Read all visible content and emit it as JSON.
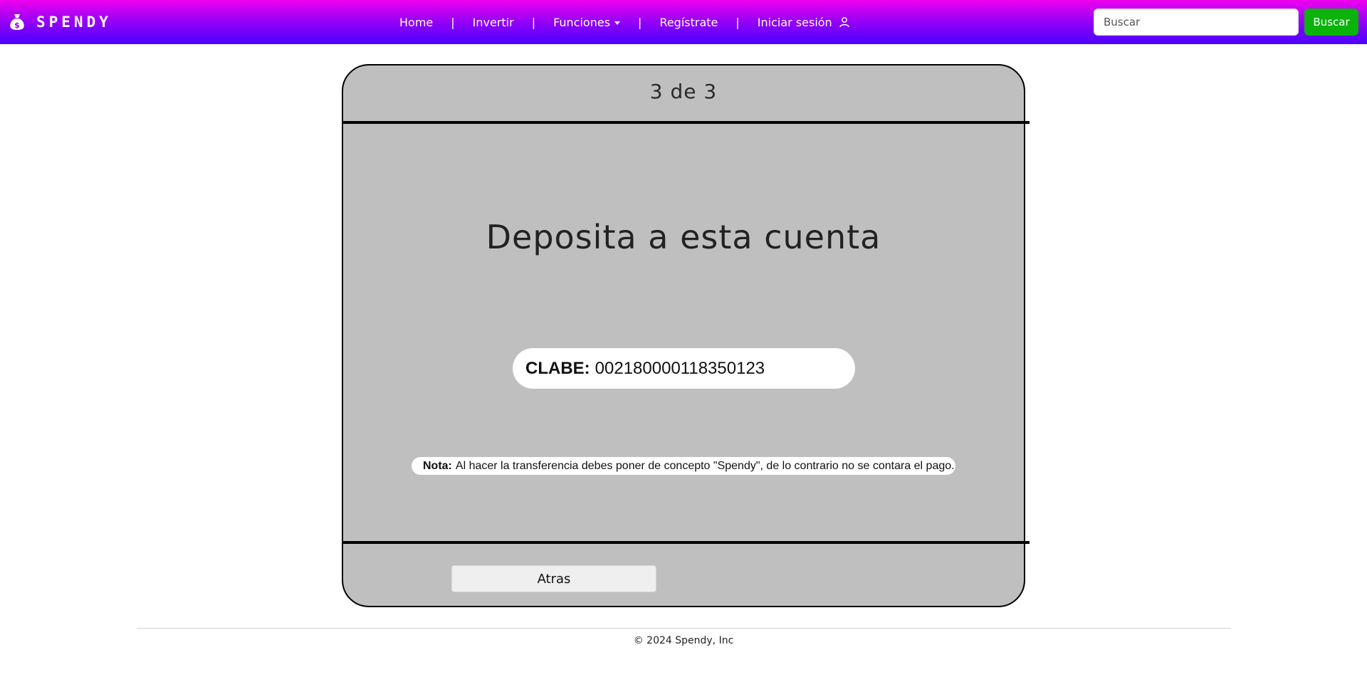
{
  "navbar": {
    "brand": "SPENDY",
    "brand_icon": "money-bag-icon",
    "links": {
      "home": "Home",
      "invertir": "Invertir",
      "funciones": "Funciones",
      "registrate": "Regístrate",
      "iniciar_sesion": "Iniciar sesión"
    },
    "separator": "|",
    "search": {
      "placeholder": "Buscar",
      "value": "",
      "button_label": "Buscar"
    },
    "colors": {
      "gradient_top": "#ee00ee",
      "gradient_bottom": "#4a00ff",
      "search_button": "#0ab30a"
    }
  },
  "card": {
    "step": "3 de 3",
    "title": "Deposita a esta cuenta",
    "clabe_label": "CLABE:",
    "clabe_value": "002180000118350123",
    "note_label": "Nota:",
    "note_text": "Al hacer la transferencia debes poner de concepto \"Spendy\", de lo contrario no se contara el pago.",
    "back_button": "Atras",
    "colors": {
      "background": "#bfbfbf"
    }
  },
  "footer": {
    "text": "© 2024 Spendy, Inc"
  }
}
